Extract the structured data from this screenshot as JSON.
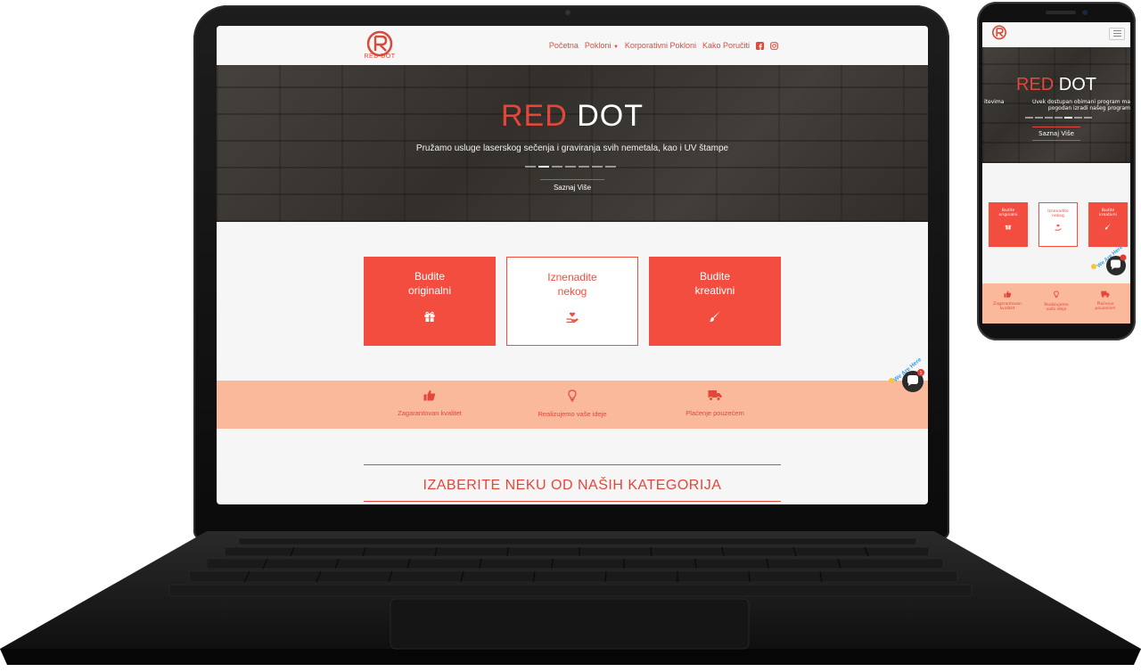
{
  "brand": {
    "logo_text": "RED DOT",
    "accent": "#e2473a",
    "card_red": "#f24d3e",
    "feature_bg": "#fab99b"
  },
  "nav": {
    "items": [
      "Početna",
      "Pokloni",
      "Korporativni Pokloni",
      "Kako Poručiti"
    ],
    "icons": [
      "facebook-icon",
      "instagram-icon"
    ]
  },
  "hero": {
    "title_red": "RED",
    "title_white": "DOT",
    "subtitle": "Pružamo usluge laserskog sečenja i graviranja svih nemetala, kao i UV štampe",
    "button": "Saznaj Više",
    "slides": 7,
    "active_slide": 2
  },
  "cards": [
    {
      "line1": "Budite",
      "line2": "originalni",
      "icon": "gift-icon",
      "style": "red"
    },
    {
      "line1": "Iznenadite",
      "line2": "nekog",
      "icon": "heart-hand-icon",
      "style": "white"
    },
    {
      "line1": "Budite",
      "line2": "kreativni",
      "icon": "brush-icon",
      "style": "red"
    }
  ],
  "features": [
    {
      "label": "Zagarantovan kvalitet",
      "icon": "thumbs-up-icon"
    },
    {
      "label": "Realizujemo vaše ideje",
      "icon": "lightbulb-icon"
    },
    {
      "label": "Plaćenje pouzećem",
      "icon": "truck-icon"
    }
  ],
  "categories_title": "IZABERITE NEKU OD NAŠIH KATEGORIJA",
  "chat": {
    "label": "We Are Here",
    "badge": "1"
  },
  "mobile": {
    "title_red": "RED",
    "title_white": "DOT",
    "sub_left": "itevima",
    "sub_right_line1": "Uvek dostupan obimani program ma",
    "sub_right_line2": "pogodan izradi našeg program",
    "button": "Saznaj Više",
    "cards": [
      {
        "line1": "Budite",
        "line2": "originalni"
      },
      {
        "line1": "Iznenadite",
        "line2": "nekog"
      },
      {
        "line1": "Budite",
        "line2": "kreativni"
      }
    ],
    "features": [
      {
        "line1": "Zagarantovan",
        "line2": "kvalitet"
      },
      {
        "line1": "Realizujemo",
        "line2": "vaše ideje"
      },
      {
        "line1": "Plaćenje",
        "line2": "pouzećem"
      }
    ]
  }
}
